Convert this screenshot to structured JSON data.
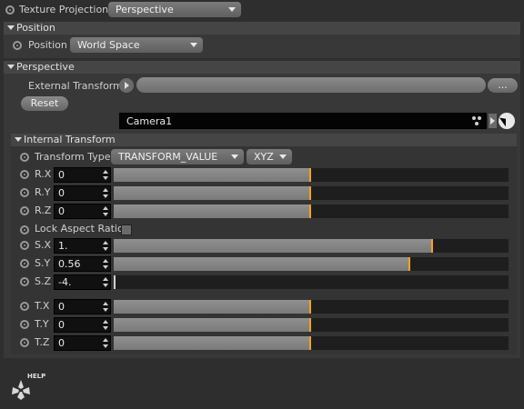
{
  "texture_projection": {
    "label": "Texture Projection",
    "value": "Perspective"
  },
  "position_group": {
    "title": "Position"
  },
  "position": {
    "label": "Position",
    "value": "World Space"
  },
  "perspective_group": {
    "title": "Perspective"
  },
  "external_transform": {
    "label": "External Transform",
    "value": "",
    "browse_label": "..."
  },
  "reset_label": "Reset",
  "camera": {
    "value": "Camera1"
  },
  "internal_group": {
    "title": "Internal Transform"
  },
  "transform_type": {
    "label": "Transform Type",
    "value": "TRANSFORM_VALUE",
    "order": "XYZ"
  },
  "rotation": [
    {
      "label": "R.X",
      "value": "0",
      "level": 0.5
    },
    {
      "label": "R.Y",
      "value": "0",
      "level": 0.5
    },
    {
      "label": "R.Z",
      "value": "0",
      "level": 0.5
    }
  ],
  "lock_aspect_label": "Lock Aspect Ratio",
  "scale": [
    {
      "label": "S.X",
      "value": "1.",
      "level": 0.808
    },
    {
      "label": "S.Y",
      "value": "0.56",
      "level": 0.75
    },
    {
      "label": "S.Z",
      "value": "-4.",
      "level": 0.0
    }
  ],
  "translation": [
    {
      "label": "T.X",
      "value": "0",
      "level": 0.5
    },
    {
      "label": "T.Y",
      "value": "0",
      "level": 0.5
    },
    {
      "label": "T.Z",
      "value": "0",
      "level": 0.5
    }
  ],
  "help_label": "HELP",
  "colors": {
    "accent": "#f2a31b",
    "panel": "#383838",
    "background": "#2e2e2e"
  }
}
